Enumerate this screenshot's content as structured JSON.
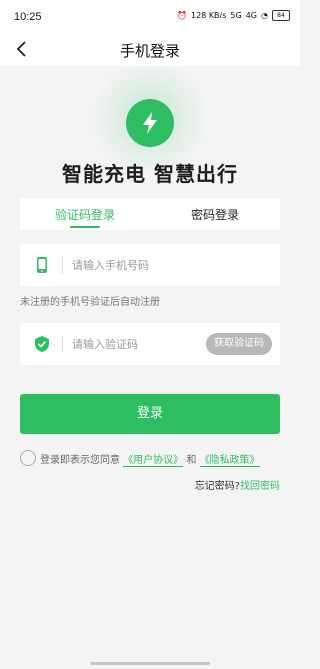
{
  "status_bar": {
    "time": "10:25",
    "net_speed": "128 KB/s",
    "signal_1": "5G",
    "signal_2": "4G",
    "battery": "84"
  },
  "header": {
    "title": "手机登录",
    "back_icon": "chevron-left-icon"
  },
  "hero": {
    "slogan": "智能充电 智慧出行",
    "logo_icon": "lightning-bolt-icon",
    "accent_color": "#2ebe61"
  },
  "tabs": [
    {
      "label": "验证码登录",
      "active": true
    },
    {
      "label": "密码登录",
      "active": false
    }
  ],
  "phone_field": {
    "placeholder": "请输入手机号码",
    "value": ""
  },
  "hint": "未注册的手机号验证后自动注册",
  "code_field": {
    "placeholder": "请输入验证码",
    "value": "",
    "get_code_label": "获取验证码"
  },
  "login_button": {
    "label": "登录"
  },
  "agreement": {
    "prefix": "登录即表示您同意",
    "user_agreement": "《用户协议》",
    "and": "和",
    "privacy_policy": "《隐私政策》",
    "checked": false
  },
  "forgot": {
    "text": "忘记密码?",
    "link": "找回密码"
  }
}
